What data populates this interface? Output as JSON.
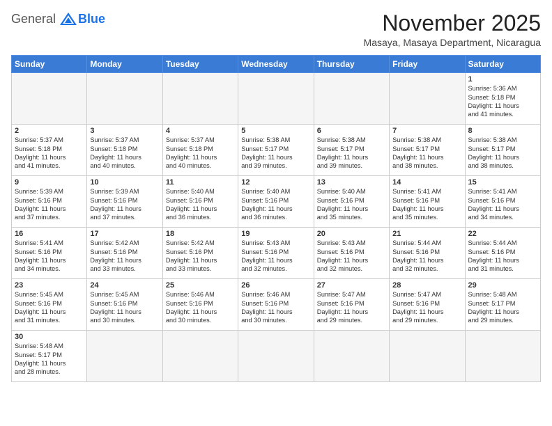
{
  "logo": {
    "general": "General",
    "blue": "Blue"
  },
  "header": {
    "month_title": "November 2025",
    "location": "Masaya, Masaya Department, Nicaragua"
  },
  "weekdays": [
    "Sunday",
    "Monday",
    "Tuesday",
    "Wednesday",
    "Thursday",
    "Friday",
    "Saturday"
  ],
  "weeks": [
    [
      {
        "day": "",
        "info": ""
      },
      {
        "day": "",
        "info": ""
      },
      {
        "day": "",
        "info": ""
      },
      {
        "day": "",
        "info": ""
      },
      {
        "day": "",
        "info": ""
      },
      {
        "day": "",
        "info": ""
      },
      {
        "day": "1",
        "info": "Sunrise: 5:36 AM\nSunset: 5:18 PM\nDaylight: 11 hours\nand 41 minutes."
      }
    ],
    [
      {
        "day": "2",
        "info": "Sunrise: 5:37 AM\nSunset: 5:18 PM\nDaylight: 11 hours\nand 41 minutes."
      },
      {
        "day": "3",
        "info": "Sunrise: 5:37 AM\nSunset: 5:18 PM\nDaylight: 11 hours\nand 40 minutes."
      },
      {
        "day": "4",
        "info": "Sunrise: 5:37 AM\nSunset: 5:18 PM\nDaylight: 11 hours\nand 40 minutes."
      },
      {
        "day": "5",
        "info": "Sunrise: 5:38 AM\nSunset: 5:17 PM\nDaylight: 11 hours\nand 39 minutes."
      },
      {
        "day": "6",
        "info": "Sunrise: 5:38 AM\nSunset: 5:17 PM\nDaylight: 11 hours\nand 39 minutes."
      },
      {
        "day": "7",
        "info": "Sunrise: 5:38 AM\nSunset: 5:17 PM\nDaylight: 11 hours\nand 38 minutes."
      },
      {
        "day": "8",
        "info": "Sunrise: 5:38 AM\nSunset: 5:17 PM\nDaylight: 11 hours\nand 38 minutes."
      }
    ],
    [
      {
        "day": "9",
        "info": "Sunrise: 5:39 AM\nSunset: 5:16 PM\nDaylight: 11 hours\nand 37 minutes."
      },
      {
        "day": "10",
        "info": "Sunrise: 5:39 AM\nSunset: 5:16 PM\nDaylight: 11 hours\nand 37 minutes."
      },
      {
        "day": "11",
        "info": "Sunrise: 5:40 AM\nSunset: 5:16 PM\nDaylight: 11 hours\nand 36 minutes."
      },
      {
        "day": "12",
        "info": "Sunrise: 5:40 AM\nSunset: 5:16 PM\nDaylight: 11 hours\nand 36 minutes."
      },
      {
        "day": "13",
        "info": "Sunrise: 5:40 AM\nSunset: 5:16 PM\nDaylight: 11 hours\nand 35 minutes."
      },
      {
        "day": "14",
        "info": "Sunrise: 5:41 AM\nSunset: 5:16 PM\nDaylight: 11 hours\nand 35 minutes."
      },
      {
        "day": "15",
        "info": "Sunrise: 5:41 AM\nSunset: 5:16 PM\nDaylight: 11 hours\nand 34 minutes."
      }
    ],
    [
      {
        "day": "16",
        "info": "Sunrise: 5:41 AM\nSunset: 5:16 PM\nDaylight: 11 hours\nand 34 minutes."
      },
      {
        "day": "17",
        "info": "Sunrise: 5:42 AM\nSunset: 5:16 PM\nDaylight: 11 hours\nand 33 minutes."
      },
      {
        "day": "18",
        "info": "Sunrise: 5:42 AM\nSunset: 5:16 PM\nDaylight: 11 hours\nand 33 minutes."
      },
      {
        "day": "19",
        "info": "Sunrise: 5:43 AM\nSunset: 5:16 PM\nDaylight: 11 hours\nand 32 minutes."
      },
      {
        "day": "20",
        "info": "Sunrise: 5:43 AM\nSunset: 5:16 PM\nDaylight: 11 hours\nand 32 minutes."
      },
      {
        "day": "21",
        "info": "Sunrise: 5:44 AM\nSunset: 5:16 PM\nDaylight: 11 hours\nand 32 minutes."
      },
      {
        "day": "22",
        "info": "Sunrise: 5:44 AM\nSunset: 5:16 PM\nDaylight: 11 hours\nand 31 minutes."
      }
    ],
    [
      {
        "day": "23",
        "info": "Sunrise: 5:45 AM\nSunset: 5:16 PM\nDaylight: 11 hours\nand 31 minutes."
      },
      {
        "day": "24",
        "info": "Sunrise: 5:45 AM\nSunset: 5:16 PM\nDaylight: 11 hours\nand 30 minutes."
      },
      {
        "day": "25",
        "info": "Sunrise: 5:46 AM\nSunset: 5:16 PM\nDaylight: 11 hours\nand 30 minutes."
      },
      {
        "day": "26",
        "info": "Sunrise: 5:46 AM\nSunset: 5:16 PM\nDaylight: 11 hours\nand 30 minutes."
      },
      {
        "day": "27",
        "info": "Sunrise: 5:47 AM\nSunset: 5:16 PM\nDaylight: 11 hours\nand 29 minutes."
      },
      {
        "day": "28",
        "info": "Sunrise: 5:47 AM\nSunset: 5:16 PM\nDaylight: 11 hours\nand 29 minutes."
      },
      {
        "day": "29",
        "info": "Sunrise: 5:48 AM\nSunset: 5:17 PM\nDaylight: 11 hours\nand 29 minutes."
      }
    ],
    [
      {
        "day": "30",
        "info": "Sunrise: 5:48 AM\nSunset: 5:17 PM\nDaylight: 11 hours\nand 28 minutes."
      },
      {
        "day": "",
        "info": ""
      },
      {
        "day": "",
        "info": ""
      },
      {
        "day": "",
        "info": ""
      },
      {
        "day": "",
        "info": ""
      },
      {
        "day": "",
        "info": ""
      },
      {
        "day": "",
        "info": ""
      }
    ]
  ]
}
